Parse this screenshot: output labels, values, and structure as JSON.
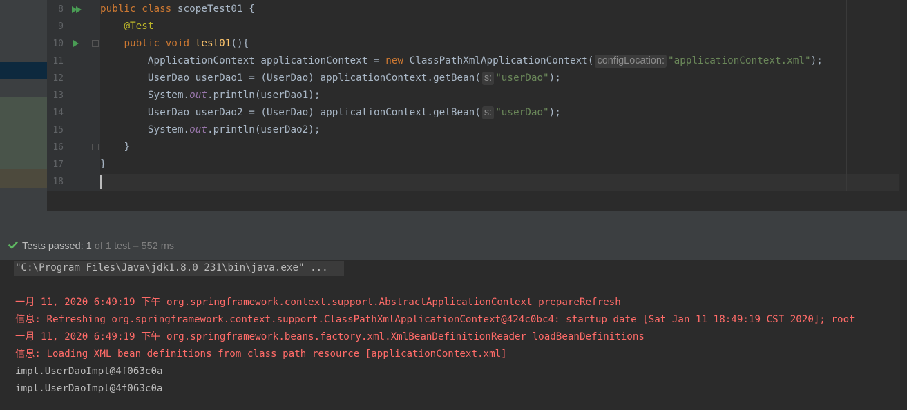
{
  "editor": {
    "line_numbers": [
      "8",
      "9",
      "10",
      "11",
      "12",
      "13",
      "14",
      "15",
      "16",
      "17",
      "18"
    ],
    "lines": {
      "l8": {
        "kw1": "public class ",
        "name": "scopeTest01 {"
      },
      "l9": {
        "ann": "@Test"
      },
      "l10": {
        "kw": "public void ",
        "fn": "test01",
        "rest": "(){"
      },
      "l11": {
        "a": "ApplicationContext applicationContext = ",
        "kw": "new",
        "b": " ClassPathXmlApplicationContext(",
        "hint": "configLocation:",
        "str": "\"applicationContext.xml\"",
        "c": ");"
      },
      "l12": {
        "a": "UserDao userDao1 = (UserDao) applicationContext.getBean(",
        "hint": "s:",
        "str": "\"userDao\"",
        "c": ");"
      },
      "l13": {
        "a": "System.",
        "st": "out",
        "b": ".println(userDao1);"
      },
      "l14": {
        "a": "UserDao userDao2 = (UserDao) applicationContext.getBean(",
        "hint": "s:",
        "str": "\"userDao\"",
        "c": ");"
      },
      "l15": {
        "a": "System.",
        "st": "out",
        "b": ".println(userDao2);"
      },
      "l16": {
        "a": "}"
      },
      "l17": {
        "a": "}"
      }
    }
  },
  "tests": {
    "label": "Tests passed: ",
    "count": "1",
    "detail": " of 1 test – 552 ms"
  },
  "console": {
    "command": "\"C:\\Program Files\\Java\\jdk1.8.0_231\\bin\\java.exe\" ...",
    "lines": [
      "一月 11, 2020 6:49:19 下午 org.springframework.context.support.AbstractApplicationContext prepareRefresh",
      "信息: Refreshing org.springframework.context.support.ClassPathXmlApplicationContext@424c0bc4: startup date [Sat Jan 11 18:49:19 CST 2020]; root",
      "一月 11, 2020 6:49:19 下午 org.springframework.beans.factory.xml.XmlBeanDefinitionReader loadBeanDefinitions",
      "信息: Loading XML bean definitions from class path resource [applicationContext.xml]",
      "impl.UserDaoImpl@4f063c0a",
      "impl.UserDaoImpl@4f063c0a"
    ]
  },
  "colors": {
    "keyword": "#cc7832",
    "string": "#6a8759",
    "annotation": "#bbb529",
    "method": "#ffc66d",
    "static_field": "#9876aa",
    "error_text": "#ff6b68",
    "pass_green": "#5fb862"
  }
}
